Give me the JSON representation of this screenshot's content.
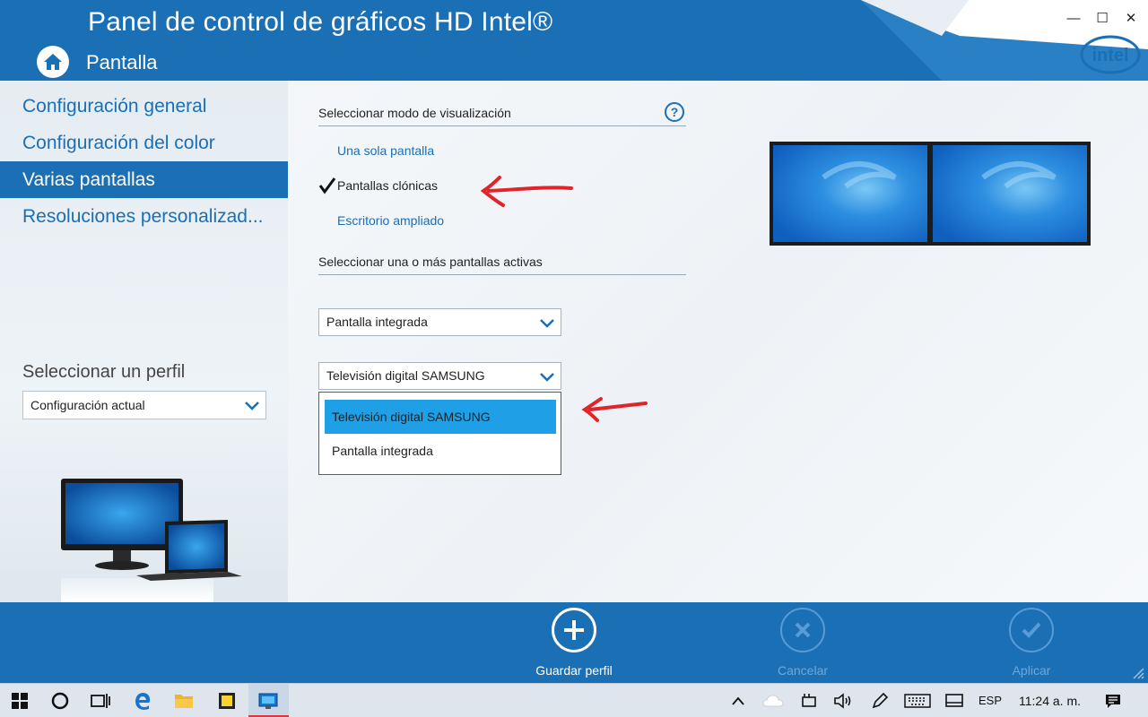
{
  "window": {
    "title": "Panel de control de gráficos HD Intel®",
    "section": "Pantalla",
    "controls": {
      "minimize": "—",
      "maximize": "☐",
      "close": "✕"
    },
    "logo_text": "intel",
    "brand_color": "#1a6fb5"
  },
  "sidebar": {
    "items": [
      {
        "label": "Configuración general",
        "active": false
      },
      {
        "label": "Configuración del color",
        "active": false
      },
      {
        "label": "Varias pantallas",
        "active": true
      },
      {
        "label": "Resoluciones personalizad...",
        "active": false
      }
    ],
    "profile_label": "Seleccionar un perfil",
    "profile_value": "Configuración actual"
  },
  "main": {
    "display_mode_heading": "Seleccionar modo de visualización",
    "help_icon": "?",
    "modes": [
      {
        "label": "Una sola pantalla",
        "selected": false
      },
      {
        "label": "Pantallas clónicas",
        "selected": true
      },
      {
        "label": "Escritorio ampliado",
        "selected": false
      }
    ],
    "active_displays_heading": "Seleccionar una o más pantallas activas",
    "display1_value": "Pantalla integrada",
    "display2_value": "Televisión digital SAMSUNG",
    "dropdown_options": [
      {
        "label": "Televisión digital SAMSUNG",
        "highlighted": true
      },
      {
        "label": "Pantalla integrada",
        "highlighted": false
      }
    ],
    "annotation_color": "#e0242a"
  },
  "bottom_bar": {
    "save_profile": "Guardar perfil",
    "cancel": "Cancelar",
    "apply": "Aplicar"
  },
  "taskbar": {
    "language": "ESP",
    "time": "11:24 a. m.",
    "icons": [
      "windows-start-icon",
      "cortana-icon",
      "task-view-icon",
      "edge-icon",
      "file-explorer-icon",
      "sticky-notes-icon",
      "intel-graphics-icon"
    ],
    "tray_icons": [
      "chevron-up-icon",
      "onedrive-icon",
      "power-icon",
      "volume-icon",
      "pen-icon",
      "keyboard-icon",
      "display-icon",
      "notifications-icon"
    ]
  }
}
